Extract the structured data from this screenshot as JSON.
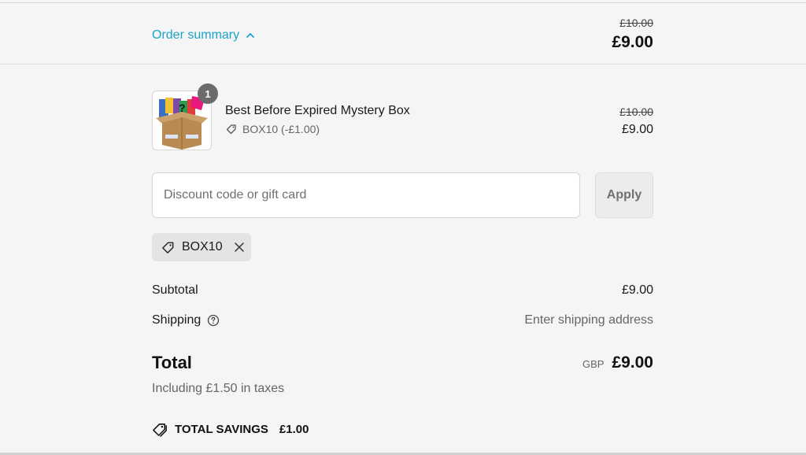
{
  "header": {
    "toggle_label": "Order summary",
    "original_total": "£10.00",
    "total": "£9.00"
  },
  "product": {
    "name": "Best Before Expired Mystery Box",
    "quantity": "1",
    "discount_label": "BOX10 (-£1.00)",
    "original_price": "£10.00",
    "price": "£9.00",
    "image": "mystery-box-image"
  },
  "discount": {
    "placeholder": "Discount code or gift card",
    "value": "",
    "apply_label": "Apply",
    "applied_code": "BOX10"
  },
  "summary": {
    "subtotal_label": "Subtotal",
    "subtotal_value": "£9.00",
    "shipping_label": "Shipping",
    "shipping_value": "Enter shipping address",
    "total_label": "Total",
    "currency": "GBP",
    "total_value": "£9.00",
    "tax_note": "Including £1.50 in taxes",
    "savings_label": "TOTAL SAVINGS",
    "savings_value": "£1.00"
  },
  "colors": {
    "accent": "#1aa3c9",
    "background": "#f5f5f5",
    "chip": "#e4e4e4"
  },
  "icons": {
    "toggle": "chevron-up-icon",
    "tag": "tag-icon",
    "remove": "close-icon",
    "help": "question-circle-icon",
    "savings": "tags-icon"
  }
}
